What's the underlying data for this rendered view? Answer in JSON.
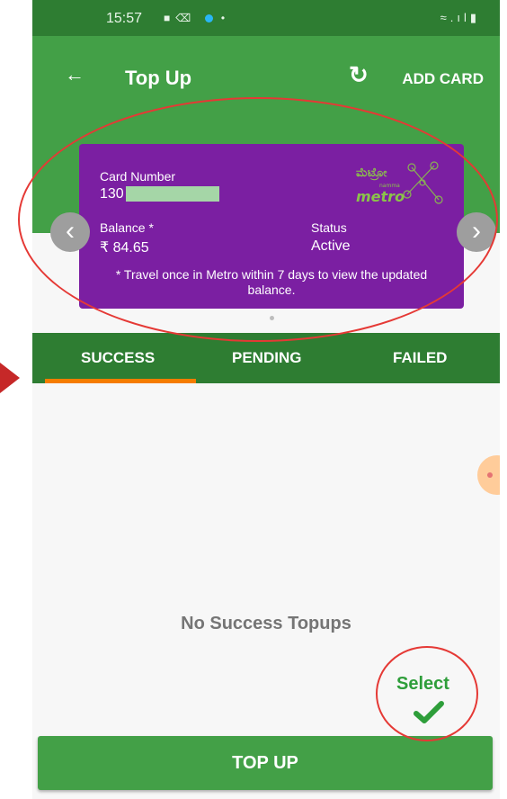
{
  "status_bar": {
    "time": "15:57",
    "right_icons": "wifi-signal-battery"
  },
  "appbar": {
    "title": "Top Up",
    "add_card_label": "ADD CARD"
  },
  "card": {
    "number_label": "Card Number",
    "number_value": "130",
    "balance_label": "Balance *",
    "balance_value": "₹ 84.65",
    "status_label": "Status",
    "status_value": "Active",
    "note": "* Travel once in Metro within 7 days to view the updated balance.",
    "logo_script": "ಮೆಟ್ರೋ",
    "logo_word": "metro",
    "logo_small": "namma"
  },
  "tabs": [
    {
      "label": "SUCCESS",
      "active": true
    },
    {
      "label": "PENDING",
      "active": false
    },
    {
      "label": "FAILED",
      "active": false
    }
  ],
  "empty_message": "No Success Topups",
  "topup_button": "TOP UP",
  "annotation": {
    "select_label": "Select"
  },
  "colors": {
    "status_bar": "#2e7d32",
    "appbar": "#43a047",
    "card": "#7b1fa2",
    "tab_indicator": "#f57c00",
    "annotation_red": "#e53935"
  }
}
